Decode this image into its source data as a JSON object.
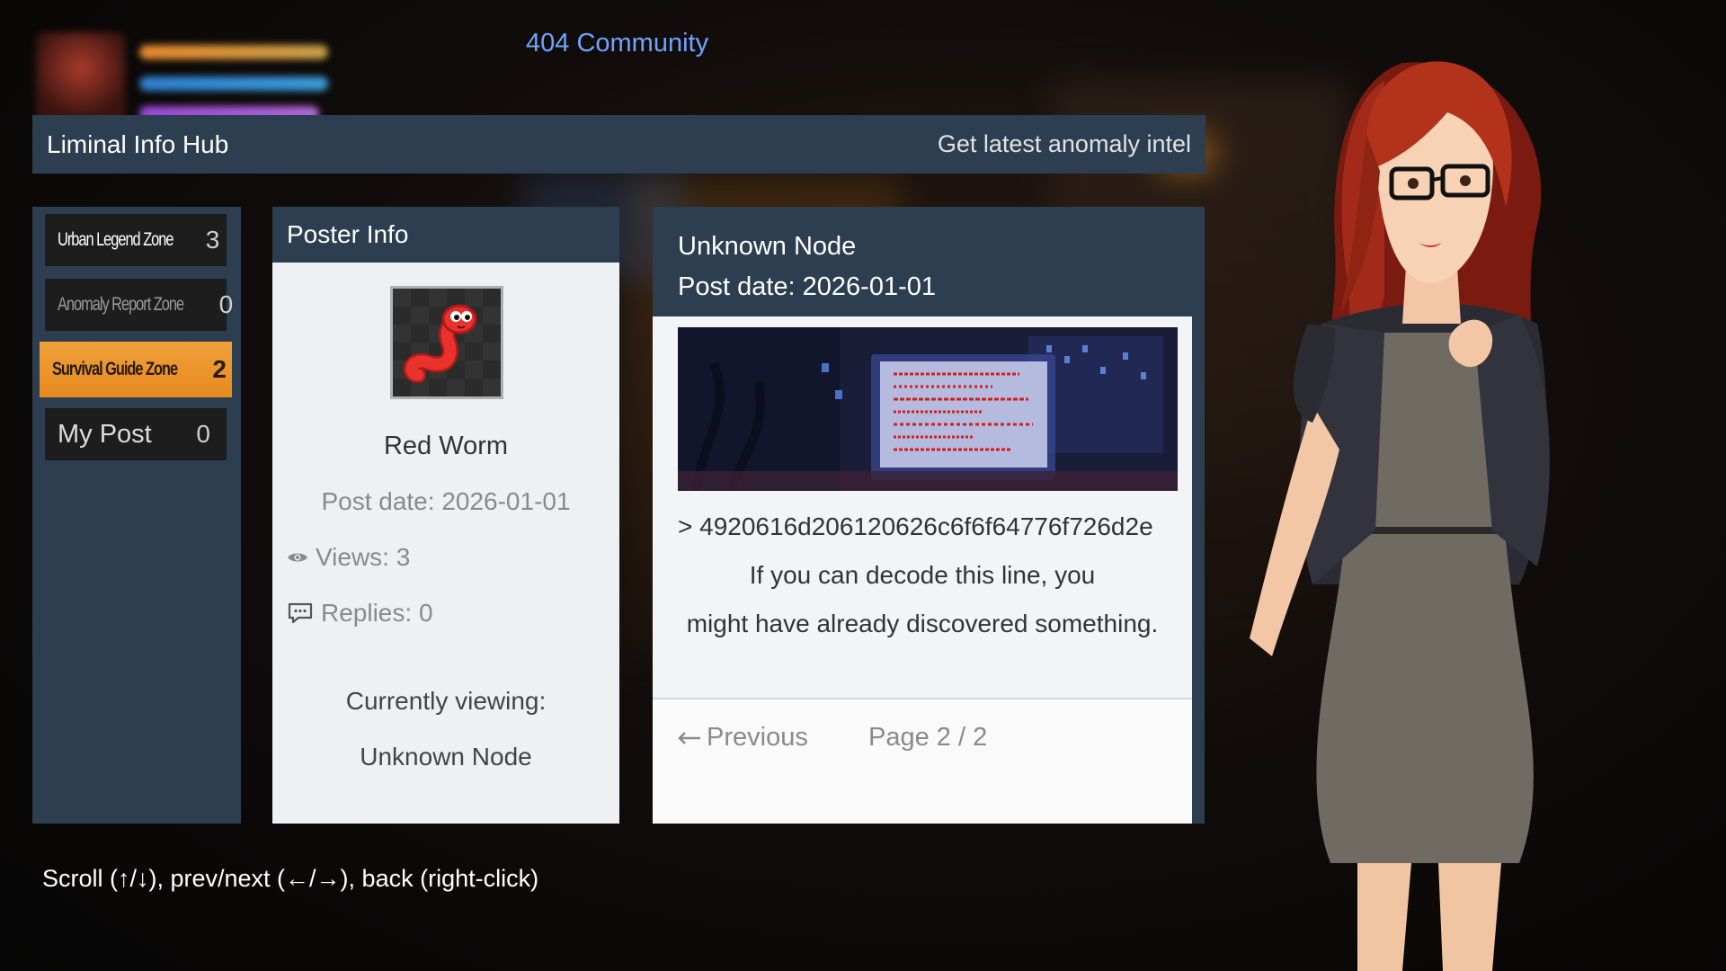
{
  "community_title": "404 Community",
  "header": {
    "title": "Liminal Info Hub",
    "subtitle_link": "Get latest anomaly intel"
  },
  "sidebar": {
    "items": [
      {
        "label": "Urban Legend Zone",
        "count": "3"
      },
      {
        "label": "Anomaly Report Zone",
        "count": "0"
      },
      {
        "label": "Survival Guide Zone",
        "count": "2"
      },
      {
        "label": "My Post",
        "count": "0"
      }
    ]
  },
  "poster_info": {
    "heading": "Poster Info",
    "name": "Red Worm",
    "post_date": "Post date: 2026-01-01",
    "views": "Views: 3",
    "replies": "Replies: 0",
    "viewing_label": "Currently viewing:",
    "viewing_value": "Unknown Node"
  },
  "post": {
    "title": "Unknown Node",
    "date": "Post date: 2026-01-01",
    "hex_line": "> 4920616d206120626c6f6f64776f726d2e",
    "line1": "If you can decode this line, you",
    "line2": "might have already discovered something.",
    "prev_label": "Previous",
    "page_indicator": "Page 2 / 2"
  },
  "controls_hint": "Scroll (↑/↓), prev/next (←/→), back (right-click)",
  "colors": {
    "panel_header": "#2c3e50",
    "active_zone": "#e68a1f",
    "title_blue": "#6fa3ff",
    "panel_body": "#eef1f4"
  }
}
